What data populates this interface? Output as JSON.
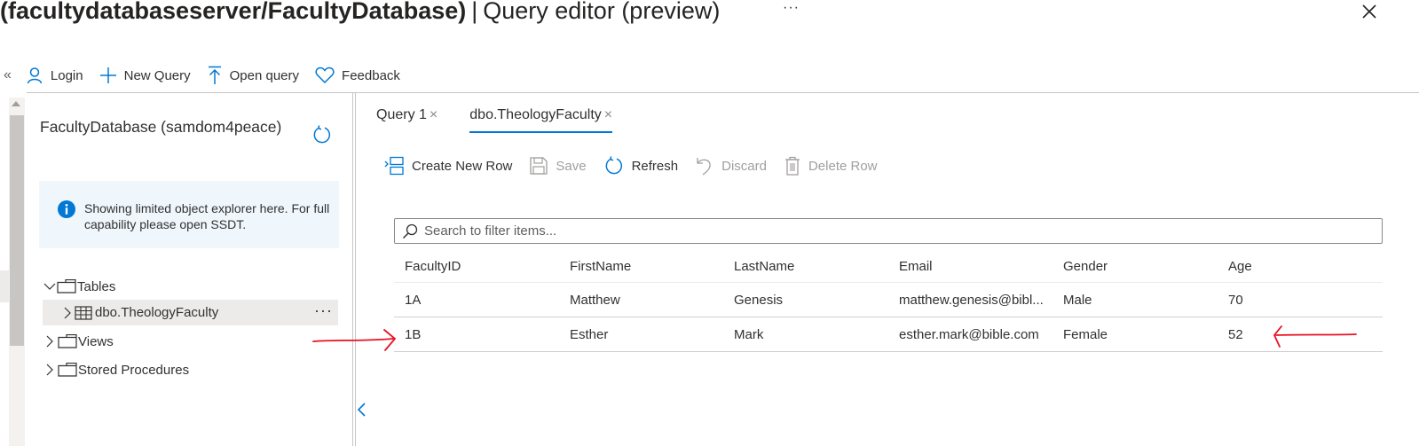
{
  "window": {
    "title_bold": "(facultydatabaseserver/FacultyDatabase)",
    "title_separator": "|",
    "title_rest": "Query editor (preview)",
    "more_label": "···",
    "close_icon": "close-icon"
  },
  "commandbar": {
    "collapse_label": "«",
    "items": [
      {
        "label": "Login",
        "icon": "person-icon"
      },
      {
        "label": "New Query",
        "icon": "plus-icon"
      },
      {
        "label": "Open query",
        "icon": "upload-icon"
      },
      {
        "label": "Feedback",
        "icon": "heart-icon"
      }
    ]
  },
  "explorer": {
    "db_title": "FacultyDatabase (samdom4peace)",
    "refresh_icon": "refresh-icon",
    "info_text": "Showing limited object explorer here. For full capability please open SSDT.",
    "tree": [
      {
        "label": "Tables",
        "expanded": true,
        "icon": "folder-icon"
      },
      {
        "label": "dbo.TheologyFaculty",
        "icon": "table-icon",
        "selected": true,
        "more": "···"
      },
      {
        "label": "Views",
        "expanded": false,
        "icon": "folder-icon"
      },
      {
        "label": "Stored Procedures",
        "expanded": false,
        "icon": "folder-icon"
      }
    ],
    "collapse_panel_label": "<"
  },
  "tabs": [
    {
      "label": "Query 1",
      "active": false,
      "close": "×"
    },
    {
      "label": "dbo.TheologyFaculty",
      "active": true,
      "close": "×"
    }
  ],
  "toolbar": {
    "create_new_row": "Create New Row",
    "save": "Save",
    "refresh": "Refresh",
    "discard": "Discard",
    "delete_row": "Delete Row"
  },
  "search": {
    "placeholder": "Search to filter items...",
    "value": ""
  },
  "grid": {
    "columns": [
      "FacultyID",
      "FirstName",
      "LastName",
      "Email",
      "Gender",
      "Age"
    ],
    "rows": [
      [
        "1A",
        "Matthew",
        "Genesis",
        "matthew.genesis@bibl...",
        "Male",
        "70"
      ],
      [
        "1B",
        "Esther",
        "Mark",
        "esther.mark@bible.com",
        "Female",
        "52"
      ]
    ]
  },
  "colors": {
    "accent": "#0078d4",
    "annotation": "#e81123",
    "info_background": "#eff6fc"
  }
}
